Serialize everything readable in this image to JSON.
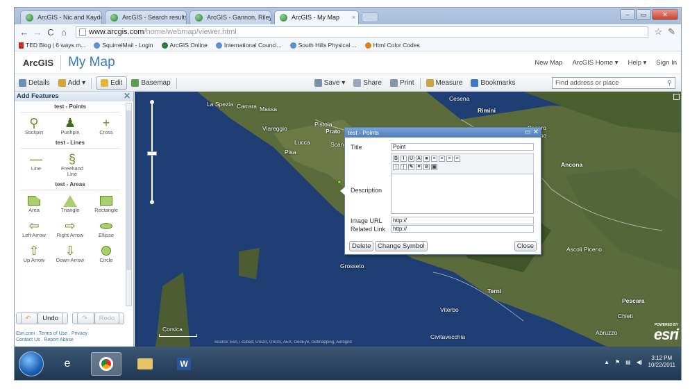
{
  "browser": {
    "tabs": [
      {
        "label": "ArcGIS - Nic and Kayden's I"
      },
      {
        "label": "ArcGIS - Search results for"
      },
      {
        "label": "ArcGIS - Gannon, Riley, Jo"
      },
      {
        "label": "ArcGIS - My Map"
      }
    ],
    "url_host": "www.arcgis.com",
    "url_path": "/home/webmap/viewer.html",
    "bookmarks": [
      "TED Blog | 6 ways m...",
      "SquirrelMail - Login",
      "ArcGIS Online",
      "International Counci...",
      "South Hills Physical ...",
      "Html Color Codes"
    ]
  },
  "header": {
    "logo": "ArcGIS",
    "title": "My Map",
    "links": [
      "New Map",
      "ArcGIS Home ▾",
      "Help ▾",
      "Sign In"
    ]
  },
  "toolbar": {
    "details": "Details",
    "add": "Add ▾",
    "edit": "Edit",
    "basemap": "Basemap",
    "save": "Save ▾",
    "share": "Share",
    "print": "Print",
    "measure": "Measure",
    "bookmarks": "Bookmarks",
    "search_placeholder": "Find address or place"
  },
  "panel": {
    "title": "Add Features",
    "points_header": "test - Points",
    "points": [
      "Stickpin",
      "Pushpin",
      "Cross"
    ],
    "lines_header": "test - Lines",
    "lines": [
      "Line",
      "Freehand Line"
    ],
    "areas_header": "test - Areas",
    "areas": [
      "Area",
      "Triangle",
      "Rectangle",
      "Left Arrow",
      "Right Arrow",
      "Ellipse",
      "Up Arrow",
      "Down Arrow",
      "Circle"
    ],
    "undo": "Undo",
    "redo": "Redo",
    "footer1": "Esri.com . Terms of Use . Privacy",
    "footer2": "Contact Us . Report Abuse"
  },
  "map": {
    "cities": [
      "La Spezia",
      "Carrara",
      "Massa",
      "Viareggio",
      "Pistoia",
      "Prato",
      "Lucca",
      "Pisa",
      "Scand",
      "Cesena",
      "Rimini",
      "Pesaro",
      "Fano",
      "Ancona",
      "Ascoli Piceno",
      "Grosseto",
      "Terni",
      "Viterbo",
      "Pescara",
      "Chieti",
      "Abruzzo",
      "Civitavecchia",
      "Corsica"
    ],
    "attribution": "Source: Esri, i-cubed, USDA, USGS, AEX, GeoEye, Getmapping, Aerogrid",
    "logo": "esri",
    "powered": "POWERED BY"
  },
  "popup": {
    "header": "test - Points",
    "title_label": "Title",
    "title_value": "Point",
    "description_label": "Description",
    "image_url_label": "Image URL",
    "image_url_value": "http://",
    "related_link_label": "Related Link",
    "related_link_value": "http://",
    "delete": "Delete",
    "change_symbol": "Change Symbol",
    "close": "Close"
  },
  "taskbar": {
    "time": "3:12 PM",
    "date": "10/22/2011"
  }
}
